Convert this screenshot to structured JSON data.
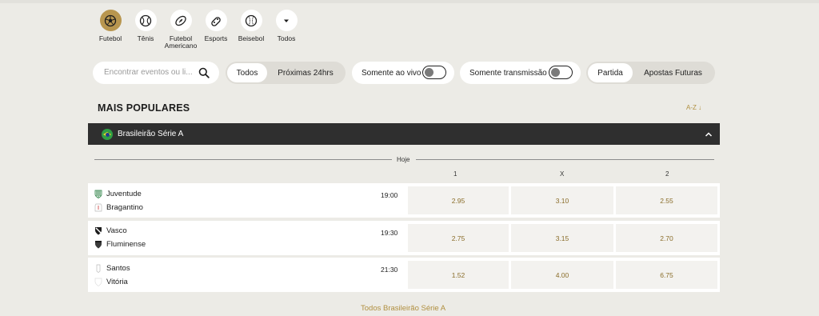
{
  "sports": [
    {
      "name": "Futebol",
      "icon": "soccer-ball-icon",
      "active": true
    },
    {
      "name": "Tênis",
      "icon": "tennis-ball-icon",
      "active": false
    },
    {
      "name": "Futebol Americano",
      "icon": "american-football-icon",
      "active": false
    },
    {
      "name": "Esports",
      "icon": "gamepad-icon",
      "active": false
    },
    {
      "name": "Beisebol",
      "icon": "baseball-icon",
      "active": false
    },
    {
      "name": "Todos",
      "icon": "chevron-down-icon",
      "active": false
    }
  ],
  "sports_labels": {
    "futebol": "Futebol",
    "tenis": "Tênis",
    "futebol_americano_l1": "Futebol",
    "futebol_americano_l2": "Americano",
    "esports": "Esports",
    "beisebol": "Beisebol",
    "todos": "Todos"
  },
  "search": {
    "placeholder": "Encontrar eventos ou li..."
  },
  "time_filter": {
    "all": "Todos",
    "next24": "Próximas 24hrs",
    "selected": "Todos"
  },
  "toggles": {
    "live": "Somente ao vivo",
    "live_on": false,
    "stream": "Somente transmissão",
    "stream_on": false
  },
  "market_filter": {
    "match": "Partida",
    "futures": "Apostas Futuras",
    "selected": "Partida"
  },
  "section": {
    "title": "MAIS POPULARES",
    "sort": "A-Z ↓"
  },
  "league": {
    "name": "Brasileirão Série A"
  },
  "day": "Hoje",
  "columns": [
    "1",
    "X",
    "2"
  ],
  "matches": [
    {
      "home": "Juventude",
      "away": "Bragantino",
      "time": "19:00",
      "odds": [
        "2.95",
        "3.10",
        "2.55"
      ]
    },
    {
      "home": "Vasco",
      "away": "Fluminense",
      "time": "19:30",
      "odds": [
        "2.75",
        "3.15",
        "2.70"
      ]
    },
    {
      "home": "Santos",
      "away": "Vitória",
      "time": "21:30",
      "odds": [
        "1.52",
        "4.00",
        "6.75"
      ]
    }
  ],
  "footer_link": "Todos Brasileirão Série A",
  "colors": {
    "accent": "#b8964f",
    "background": "#ecebe6",
    "league_bar": "#2f2f2f"
  }
}
